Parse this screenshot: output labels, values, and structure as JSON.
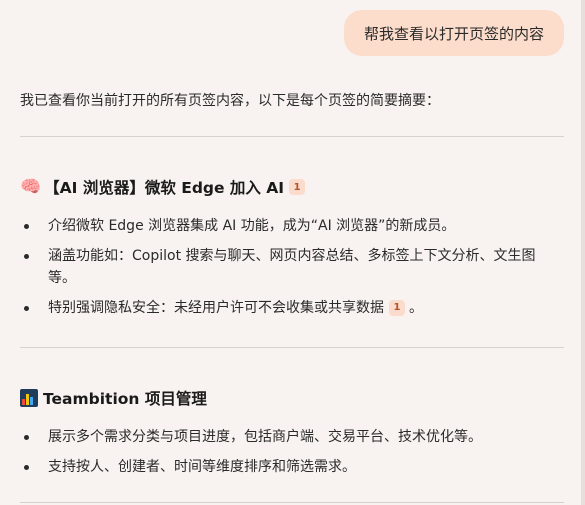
{
  "user_message": "帮我查看以打开页签的内容",
  "intro": "我已查看你当前打开的所有页签内容，以下是每个页签的简要摘要：",
  "sections": [
    {
      "emoji": "🧠",
      "title": "【AI 浏览器】微软 Edge 加入 AI",
      "cite": "1",
      "items": [
        {
          "text": "介绍微软 Edge 浏览器集成 AI 功能，成为“AI 浏览器”的新成员。"
        },
        {
          "text": "涵盖功能如：Copilot 搜索与聊天、网页内容总结、多标签上下文分析、文生图等。"
        },
        {
          "text": "特别强调隐私安全：未经用户许可不会收集或共享数据",
          "cite": "1",
          "suffix": "。"
        }
      ]
    },
    {
      "icon": "bar-chart-icon",
      "title": "Teambition 项目管理",
      "items": [
        {
          "text": "展示多个需求分类与项目进度，包括商户端、交易平台、技术优化等。"
        },
        {
          "text": "支持按人、创建者、时间等维度排序和筛选需求。"
        }
      ]
    }
  ],
  "colors": {
    "background": "#f8f3f0",
    "user_bubble": "#fcdccb",
    "cite_badge_bg": "#fbdccc",
    "cite_badge_text": "#b3552a",
    "divider": "#d9d1cc"
  }
}
